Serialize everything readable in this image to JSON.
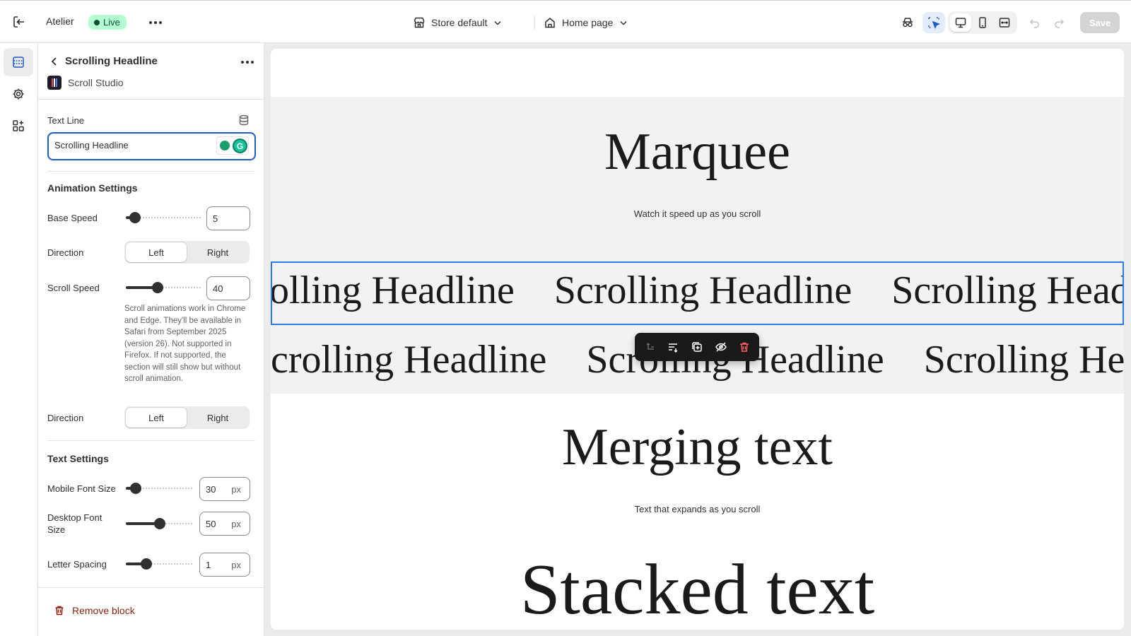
{
  "topbar": {
    "app_name": "Atelier",
    "status": "Live",
    "store_selector": "Store default",
    "page_selector": "Home page",
    "save_label": "Save"
  },
  "panel": {
    "title": "Scrolling Headline",
    "app_name": "Scroll Studio",
    "text_line_label": "Text Line",
    "text_line_value": "Scrolling Headline",
    "animation_heading": "Animation Settings",
    "base_speed_label": "Base Speed",
    "base_speed_value": "5",
    "base_speed_fraction": 0.12,
    "direction_label": "Direction",
    "direction_left": "Left",
    "direction_right": "Right",
    "scroll_speed_label": "Scroll Speed",
    "scroll_speed_value": "40",
    "scroll_speed_fraction": 0.42,
    "scroll_help": "Scroll animations work in Chrome and Edge. They'll be available in Safari from September 2025 (version 26). Not supported in Firefox. If not supported, the section will still show but without scroll animation.",
    "direction2_label": "Direction",
    "text_heading": "Text Settings",
    "mobile_font_label": "Mobile Font Size",
    "mobile_font_value": "30",
    "desktop_font_label_1": "Desktop Font",
    "desktop_font_label_2": "Size",
    "desktop_font_value": "50",
    "letter_spacing_label": "Letter Spacing",
    "letter_spacing_value": "1",
    "unit_px": "px",
    "remove_label": "Remove block"
  },
  "canvas": {
    "marquee_title": "Marquee",
    "marquee_caption": "Watch it speed up as you scroll",
    "row1": [
      "olling Headline",
      "Scrolling Headline",
      "Scrolling Headline"
    ],
    "row2": [
      "crolling Headline",
      "Scrolling Headline",
      "Scrolling Headli"
    ],
    "merging_title": "Merging text",
    "merging_caption": "Text that expands as you scroll",
    "stacked_title": "Stacked text"
  },
  "colors": {
    "accent": "#2a7be4",
    "live_bg": "#b4fed2",
    "danger": "#8e1f0b"
  }
}
